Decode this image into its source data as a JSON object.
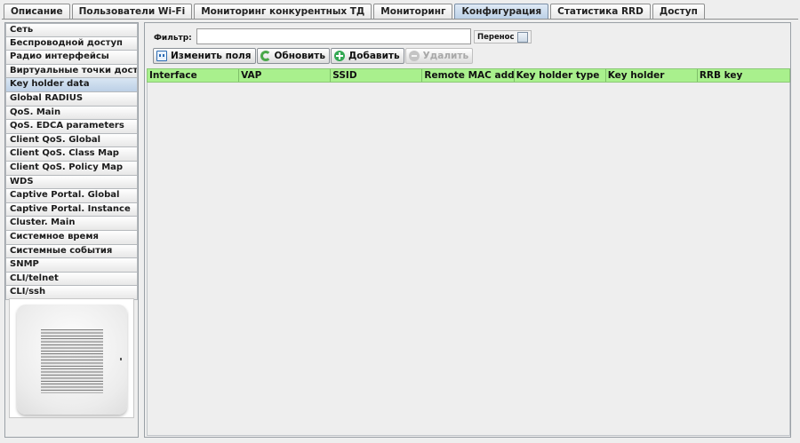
{
  "tabs": [
    {
      "label": "Описание"
    },
    {
      "label": "Пользователи Wi-Fi"
    },
    {
      "label": "Мониторинг конкурентных ТД"
    },
    {
      "label": "Мониторинг"
    },
    {
      "label": "Конфигурация"
    },
    {
      "label": "Статистика RRD"
    },
    {
      "label": "Доступ"
    }
  ],
  "active_tab": "Конфигурация",
  "sidebar": {
    "items": [
      {
        "label": "Сеть"
      },
      {
        "label": "Беспроводной доступ"
      },
      {
        "label": "Радио интерфейсы"
      },
      {
        "label": "Виртуальные точки доступа"
      },
      {
        "label": "Key holder data"
      },
      {
        "label": "Global RADIUS"
      },
      {
        "label": "QoS. Main"
      },
      {
        "label": "QoS. EDCA parameters"
      },
      {
        "label": "Client QoS. Global"
      },
      {
        "label": "Client QoS. Class Map"
      },
      {
        "label": "Client QoS. Policy Map"
      },
      {
        "label": "WDS"
      },
      {
        "label": "Captive Portal. Global"
      },
      {
        "label": "Captive Portal. Instance"
      },
      {
        "label": "Cluster. Main"
      },
      {
        "label": "Системное время"
      },
      {
        "label": "Системные события"
      },
      {
        "label": "SNMP"
      },
      {
        "label": "CLI/telnet"
      },
      {
        "label": "CLI/ssh"
      }
    ],
    "active_item": "Key holder data"
  },
  "filter": {
    "label": "Фильтр:",
    "value": "",
    "wrap_label": "Перенос",
    "wrap_checked": false
  },
  "toolbar": {
    "edit_fields": "Изменить поля",
    "refresh": "Обновить",
    "add": "Добавить",
    "delete": "Удалить"
  },
  "icons": {
    "edit_fields": "fields-icon",
    "refresh": "refresh-icon",
    "add": "add-icon",
    "delete": "delete-icon"
  },
  "table": {
    "columns": [
      "Interface",
      "VAP",
      "SSID",
      "Remote MAC address",
      "Key holder type",
      "Key holder",
      "RRB key"
    ],
    "rows": []
  },
  "colors": {
    "header_bg": "#a9f08d",
    "active_tab": "#b9cfe6"
  }
}
